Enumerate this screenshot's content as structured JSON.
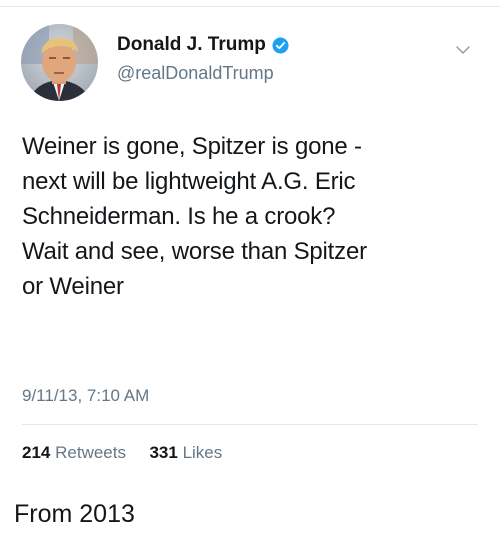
{
  "tweet": {
    "author": {
      "display_name": "Donald J. Trump",
      "handle": "@realDonaldTrump",
      "verified": true,
      "avatar": "portrait-photo"
    },
    "text_lines": [
      "Weiner is gone, Spitzer is gone -",
      "next will be lightweight A.G. Eric",
      "Schneiderman. Is he a crook?",
      "Wait and see, worse than Spitzer",
      "or Weiner"
    ],
    "timestamp": "9/11/13, 7:10 AM",
    "stats": {
      "retweets_count": "214",
      "retweets_label": "Retweets",
      "likes_count": "331",
      "likes_label": "Likes"
    },
    "menu_icon": "chevron-down-icon",
    "verified_icon": "verified-badge-icon"
  },
  "caption": "From 2013",
  "colors": {
    "text_primary": "#14171a",
    "text_secondary": "#657786",
    "verified_blue": "#1da1f2",
    "divider": "#e1e8ed"
  }
}
